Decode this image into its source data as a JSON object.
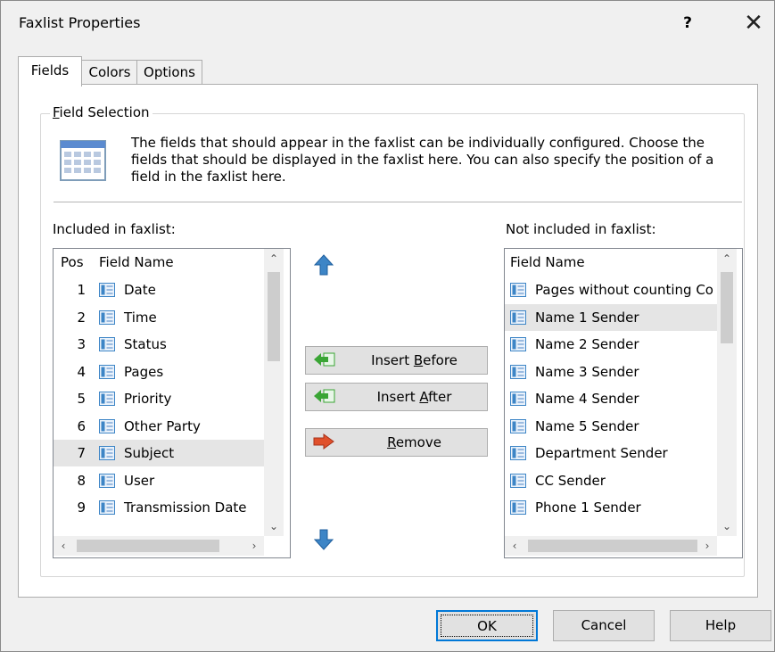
{
  "window": {
    "title": "Faxlist Properties",
    "help_glyph": "?",
    "close_glyph": "✕"
  },
  "tabs": [
    {
      "label": "Fields",
      "active": true
    },
    {
      "label": "Colors",
      "active": false
    },
    {
      "label": "Options",
      "active": false
    }
  ],
  "field_selection": {
    "group_label_mnemonic": "F",
    "group_label_rest": "ield Selection",
    "description": "The fields that should appear in the faxlist can be individually configured. Choose the fields that should be displayed in the faxlist here. You can also specify the position of a field in the faxlist here.",
    "icon": "calendar-grid-icon"
  },
  "included": {
    "label": "Included in faxlist:",
    "col_pos": "Pos",
    "col_name": "Field Name",
    "selected_index": 6,
    "rows": [
      {
        "pos": "1",
        "name": "Date"
      },
      {
        "pos": "2",
        "name": "Time"
      },
      {
        "pos": "3",
        "name": "Status"
      },
      {
        "pos": "4",
        "name": "Pages"
      },
      {
        "pos": "5",
        "name": "Priority"
      },
      {
        "pos": "6",
        "name": "Other Party"
      },
      {
        "pos": "7",
        "name": "Subject"
      },
      {
        "pos": "8",
        "name": "User"
      },
      {
        "pos": "9",
        "name": "Transmission Date"
      }
    ]
  },
  "not_included": {
    "label": "Not included in faxlist:",
    "col_name": "Field Name",
    "selected_index": 1,
    "rows": [
      {
        "name": "Pages without counting Co"
      },
      {
        "name": "Name 1 Sender"
      },
      {
        "name": "Name 2 Sender"
      },
      {
        "name": "Name 3 Sender"
      },
      {
        "name": "Name 4 Sender"
      },
      {
        "name": "Name 5 Sender"
      },
      {
        "name": "Department Sender"
      },
      {
        "name": "CC Sender"
      },
      {
        "name": "Phone 1 Sender"
      }
    ]
  },
  "middle": {
    "insert_before": {
      "pre": "Insert ",
      "mn": "B",
      "post": "efore"
    },
    "insert_after": {
      "pre": "Insert ",
      "mn": "A",
      "post": "fter"
    },
    "remove": {
      "pre": "",
      "mn": "R",
      "post": "emove"
    },
    "move_up_icon": "arrow-up-icon",
    "move_down_icon": "arrow-down-icon"
  },
  "buttons": {
    "ok": "OK",
    "cancel": "Cancel",
    "help": "Help"
  },
  "colors": {
    "icon_blue": "#3d85c6",
    "insert_green": "#3aa535",
    "remove_red": "#e0502b"
  }
}
